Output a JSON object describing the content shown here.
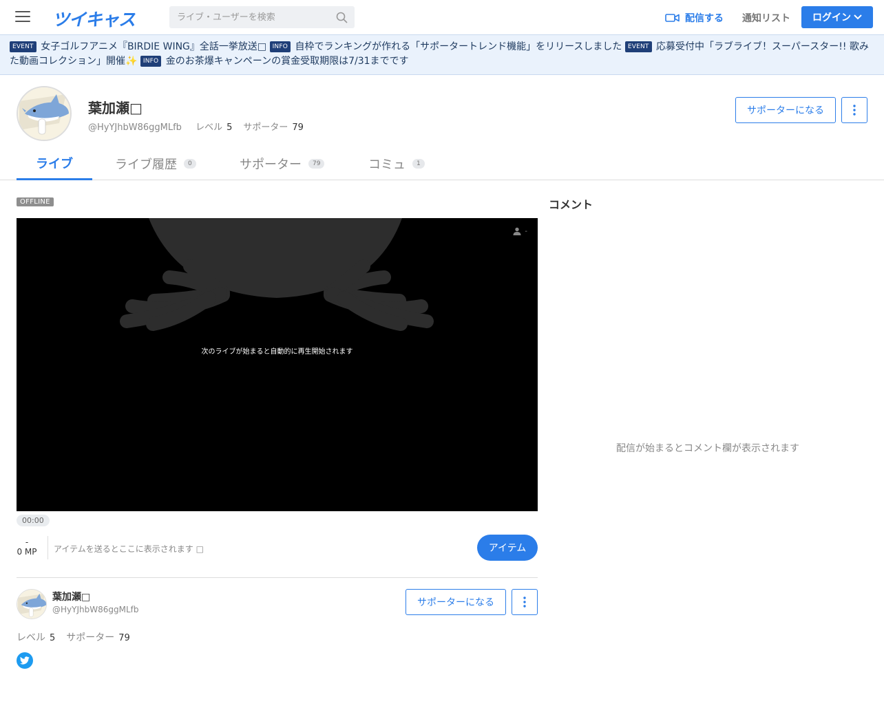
{
  "header": {
    "logo": "ツイキャス",
    "search_placeholder": "ライブ・ユーザーを検索",
    "broadcast_label": "配信する",
    "notify_label": "通知リスト",
    "login_label": "ログイン"
  },
  "banner": {
    "items": [
      {
        "tag": "EVENT",
        "text": "女子ゴルフアニメ『BIRDIE WING』全話一挙放送□"
      },
      {
        "tag": "INFO",
        "text": "自枠でランキングが作れる「サポータートレンド機能」をリリースしました"
      },
      {
        "tag": "EVENT",
        "text": "応募受付中「ラブライブ！スーパースター!! 歌みた動画コレクション」開催✨"
      },
      {
        "tag": "INFO",
        "text": "金のお茶爆キャンペーンの賞金受取期限は7/31までです"
      }
    ]
  },
  "profile": {
    "name": "葉加瀬□",
    "handle": "@HyYJhbW86ggMLfb",
    "level_label": "レベル",
    "level": "5",
    "supporter_label": "サポーター",
    "supporters": "79",
    "supporter_button": "サポーターになる"
  },
  "tabs": [
    {
      "label": "ライブ",
      "count": ""
    },
    {
      "label": "ライブ履歴",
      "count": "0"
    },
    {
      "label": "サポーター",
      "count": "79"
    },
    {
      "label": "コミュ",
      "count": "1"
    }
  ],
  "player": {
    "status": "OFFLINE",
    "viewer_count": "-",
    "message": "次のライブが始まると自動的に再生開始されます",
    "time": "00:00"
  },
  "items": {
    "mp_top": "-",
    "mp": "0 MP",
    "placeholder": "アイテムを送るとここに表示されます □",
    "button": "アイテム"
  },
  "user_card": {
    "name": "葉加瀬□",
    "handle": "@HyYJhbW86ggMLfb",
    "level_label": "レベル",
    "level": "5",
    "supporter_label": "サポーター",
    "supporters": "79",
    "supporter_button": "サポーターになる"
  },
  "comments": {
    "title": "コメント",
    "empty_message": "配信が始まるとコメント欄が表示されます"
  },
  "colors": {
    "accent": "#2b7de9",
    "banner_bg": "#eaf2fc",
    "tag_bg": "#1f3f78",
    "offline_badge": "#8e8e8e",
    "twitter": "#1d9bf0"
  },
  "icons": [
    "hamburger-menu-icon",
    "search-icon",
    "video-camera-icon",
    "chevron-down-icon",
    "kebab-menu-icon",
    "person-icon",
    "twitter-bird-icon"
  ]
}
